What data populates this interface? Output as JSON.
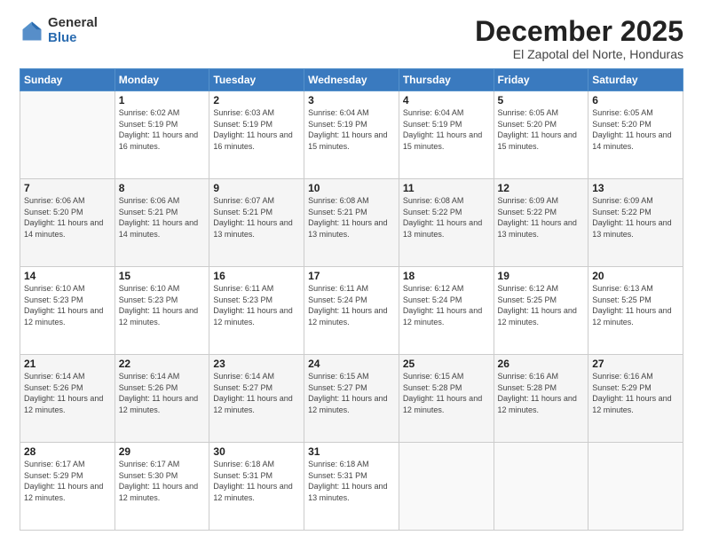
{
  "header": {
    "logo_general": "General",
    "logo_blue": "Blue",
    "month_title": "December 2025",
    "location": "El Zapotal del Norte, Honduras"
  },
  "days_of_week": [
    "Sunday",
    "Monday",
    "Tuesday",
    "Wednesday",
    "Thursday",
    "Friday",
    "Saturday"
  ],
  "weeks": [
    [
      {
        "day": "",
        "sunrise": "",
        "sunset": "",
        "daylight": ""
      },
      {
        "day": "1",
        "sunrise": "Sunrise: 6:02 AM",
        "sunset": "Sunset: 5:19 PM",
        "daylight": "Daylight: 11 hours and 16 minutes."
      },
      {
        "day": "2",
        "sunrise": "Sunrise: 6:03 AM",
        "sunset": "Sunset: 5:19 PM",
        "daylight": "Daylight: 11 hours and 16 minutes."
      },
      {
        "day": "3",
        "sunrise": "Sunrise: 6:04 AM",
        "sunset": "Sunset: 5:19 PM",
        "daylight": "Daylight: 11 hours and 15 minutes."
      },
      {
        "day": "4",
        "sunrise": "Sunrise: 6:04 AM",
        "sunset": "Sunset: 5:19 PM",
        "daylight": "Daylight: 11 hours and 15 minutes."
      },
      {
        "day": "5",
        "sunrise": "Sunrise: 6:05 AM",
        "sunset": "Sunset: 5:20 PM",
        "daylight": "Daylight: 11 hours and 15 minutes."
      },
      {
        "day": "6",
        "sunrise": "Sunrise: 6:05 AM",
        "sunset": "Sunset: 5:20 PM",
        "daylight": "Daylight: 11 hours and 14 minutes."
      }
    ],
    [
      {
        "day": "7",
        "sunrise": "Sunrise: 6:06 AM",
        "sunset": "Sunset: 5:20 PM",
        "daylight": "Daylight: 11 hours and 14 minutes."
      },
      {
        "day": "8",
        "sunrise": "Sunrise: 6:06 AM",
        "sunset": "Sunset: 5:21 PM",
        "daylight": "Daylight: 11 hours and 14 minutes."
      },
      {
        "day": "9",
        "sunrise": "Sunrise: 6:07 AM",
        "sunset": "Sunset: 5:21 PM",
        "daylight": "Daylight: 11 hours and 13 minutes."
      },
      {
        "day": "10",
        "sunrise": "Sunrise: 6:08 AM",
        "sunset": "Sunset: 5:21 PM",
        "daylight": "Daylight: 11 hours and 13 minutes."
      },
      {
        "day": "11",
        "sunrise": "Sunrise: 6:08 AM",
        "sunset": "Sunset: 5:22 PM",
        "daylight": "Daylight: 11 hours and 13 minutes."
      },
      {
        "day": "12",
        "sunrise": "Sunrise: 6:09 AM",
        "sunset": "Sunset: 5:22 PM",
        "daylight": "Daylight: 11 hours and 13 minutes."
      },
      {
        "day": "13",
        "sunrise": "Sunrise: 6:09 AM",
        "sunset": "Sunset: 5:22 PM",
        "daylight": "Daylight: 11 hours and 13 minutes."
      }
    ],
    [
      {
        "day": "14",
        "sunrise": "Sunrise: 6:10 AM",
        "sunset": "Sunset: 5:23 PM",
        "daylight": "Daylight: 11 hours and 12 minutes."
      },
      {
        "day": "15",
        "sunrise": "Sunrise: 6:10 AM",
        "sunset": "Sunset: 5:23 PM",
        "daylight": "Daylight: 11 hours and 12 minutes."
      },
      {
        "day": "16",
        "sunrise": "Sunrise: 6:11 AM",
        "sunset": "Sunset: 5:23 PM",
        "daylight": "Daylight: 11 hours and 12 minutes."
      },
      {
        "day": "17",
        "sunrise": "Sunrise: 6:11 AM",
        "sunset": "Sunset: 5:24 PM",
        "daylight": "Daylight: 11 hours and 12 minutes."
      },
      {
        "day": "18",
        "sunrise": "Sunrise: 6:12 AM",
        "sunset": "Sunset: 5:24 PM",
        "daylight": "Daylight: 11 hours and 12 minutes."
      },
      {
        "day": "19",
        "sunrise": "Sunrise: 6:12 AM",
        "sunset": "Sunset: 5:25 PM",
        "daylight": "Daylight: 11 hours and 12 minutes."
      },
      {
        "day": "20",
        "sunrise": "Sunrise: 6:13 AM",
        "sunset": "Sunset: 5:25 PM",
        "daylight": "Daylight: 11 hours and 12 minutes."
      }
    ],
    [
      {
        "day": "21",
        "sunrise": "Sunrise: 6:14 AM",
        "sunset": "Sunset: 5:26 PM",
        "daylight": "Daylight: 11 hours and 12 minutes."
      },
      {
        "day": "22",
        "sunrise": "Sunrise: 6:14 AM",
        "sunset": "Sunset: 5:26 PM",
        "daylight": "Daylight: 11 hours and 12 minutes."
      },
      {
        "day": "23",
        "sunrise": "Sunrise: 6:14 AM",
        "sunset": "Sunset: 5:27 PM",
        "daylight": "Daylight: 11 hours and 12 minutes."
      },
      {
        "day": "24",
        "sunrise": "Sunrise: 6:15 AM",
        "sunset": "Sunset: 5:27 PM",
        "daylight": "Daylight: 11 hours and 12 minutes."
      },
      {
        "day": "25",
        "sunrise": "Sunrise: 6:15 AM",
        "sunset": "Sunset: 5:28 PM",
        "daylight": "Daylight: 11 hours and 12 minutes."
      },
      {
        "day": "26",
        "sunrise": "Sunrise: 6:16 AM",
        "sunset": "Sunset: 5:28 PM",
        "daylight": "Daylight: 11 hours and 12 minutes."
      },
      {
        "day": "27",
        "sunrise": "Sunrise: 6:16 AM",
        "sunset": "Sunset: 5:29 PM",
        "daylight": "Daylight: 11 hours and 12 minutes."
      }
    ],
    [
      {
        "day": "28",
        "sunrise": "Sunrise: 6:17 AM",
        "sunset": "Sunset: 5:29 PM",
        "daylight": "Daylight: 11 hours and 12 minutes."
      },
      {
        "day": "29",
        "sunrise": "Sunrise: 6:17 AM",
        "sunset": "Sunset: 5:30 PM",
        "daylight": "Daylight: 11 hours and 12 minutes."
      },
      {
        "day": "30",
        "sunrise": "Sunrise: 6:18 AM",
        "sunset": "Sunset: 5:31 PM",
        "daylight": "Daylight: 11 hours and 12 minutes."
      },
      {
        "day": "31",
        "sunrise": "Sunrise: 6:18 AM",
        "sunset": "Sunset: 5:31 PM",
        "daylight": "Daylight: 11 hours and 13 minutes."
      },
      {
        "day": "",
        "sunrise": "",
        "sunset": "",
        "daylight": ""
      },
      {
        "day": "",
        "sunrise": "",
        "sunset": "",
        "daylight": ""
      },
      {
        "day": "",
        "sunrise": "",
        "sunset": "",
        "daylight": ""
      }
    ]
  ]
}
